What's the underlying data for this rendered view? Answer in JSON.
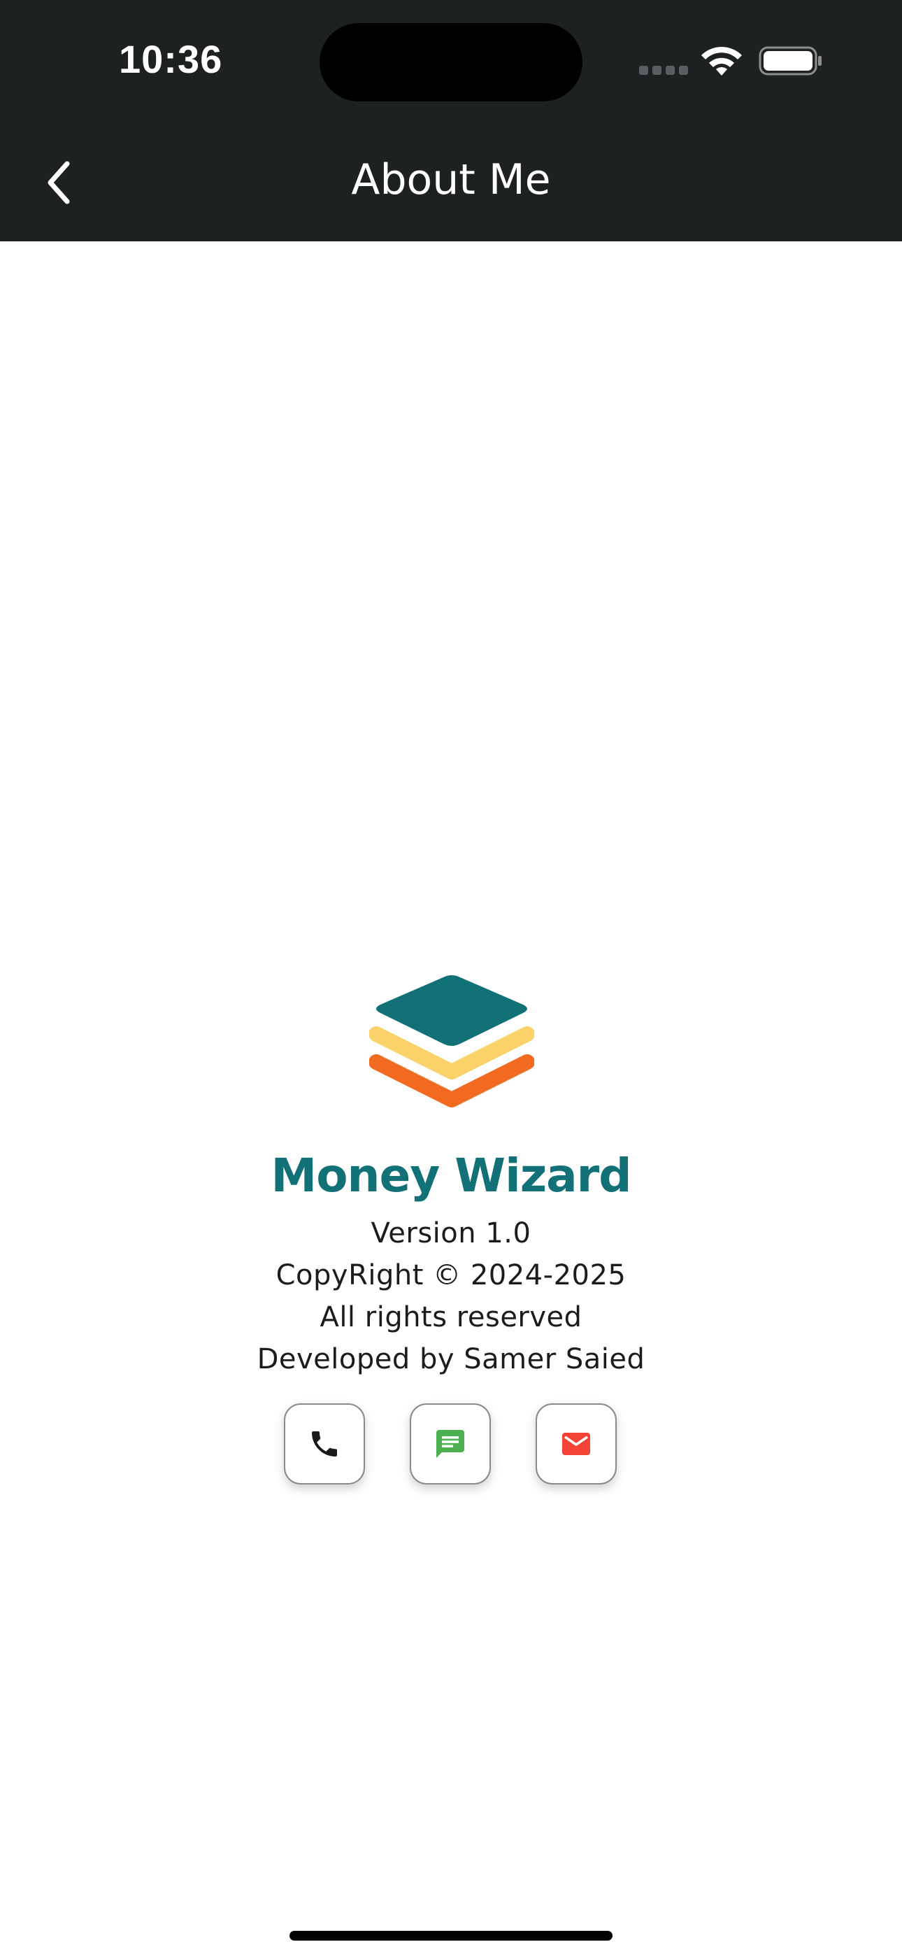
{
  "status_bar": {
    "time": "10:36"
  },
  "nav": {
    "title": "About Me",
    "back_icon": "chevron-left-icon"
  },
  "app": {
    "name": "Money Wizard",
    "logo_icon": "stacked-layers-logo",
    "info": {
      "version": "Version 1.0",
      "copyright": "CopyRight © 2024-2025",
      "rights": "All rights reserved",
      "developer": "Developed by Samer Saied"
    }
  },
  "contact_buttons": [
    {
      "icon": "phone-icon",
      "color": "#1a1a1a"
    },
    {
      "icon": "message-icon",
      "color": "#4caf50"
    },
    {
      "icon": "email-icon",
      "color": "#f44336"
    }
  ],
  "colors": {
    "header_bg": "#1e2122",
    "brand_teal": "#127176",
    "logo_yellow": "#fbd26a",
    "logo_orange": "#f26a1f"
  }
}
